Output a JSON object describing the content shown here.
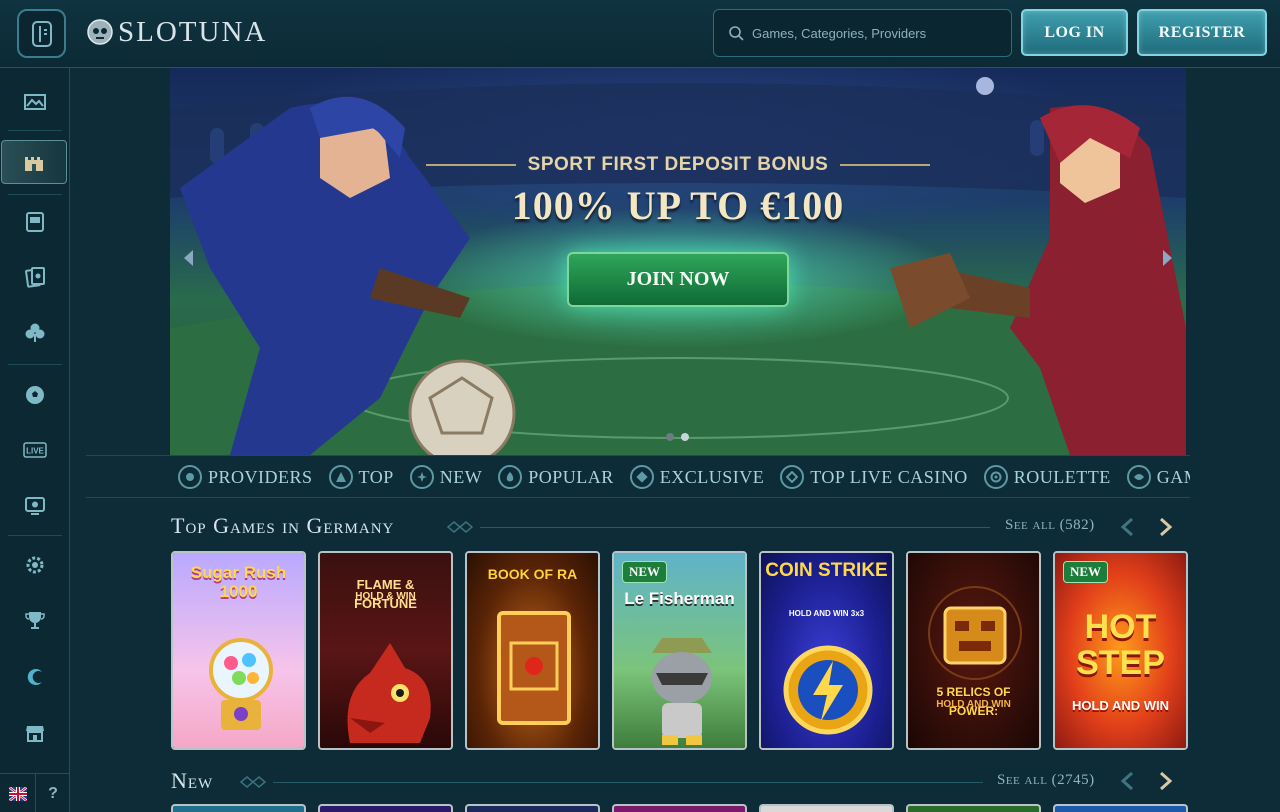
{
  "header": {
    "logo_text": "SLOTUNA",
    "search_placeholder": "Games, Categories, Providers",
    "login_label": "LOG IN",
    "register_label": "REGISTER"
  },
  "sidebar": {
    "items": [
      {
        "icon": "slots-icon",
        "active": false
      },
      {
        "icon": "castle-icon",
        "active": true
      },
      {
        "icon": "slot-machine-icon",
        "active": false
      },
      {
        "icon": "cards-icon",
        "active": false
      },
      {
        "icon": "club-icon",
        "active": false
      },
      {
        "icon": "soccer-ball-icon",
        "active": false
      },
      {
        "icon": "live-icon",
        "active": false,
        "label": "LIVE"
      },
      {
        "icon": "esports-icon",
        "active": false
      },
      {
        "icon": "gear-badge-icon",
        "active": false
      },
      {
        "icon": "trophy-icon",
        "active": false
      },
      {
        "icon": "crescent-icon",
        "active": false
      },
      {
        "icon": "shop-icon",
        "active": false
      }
    ],
    "language": "EN",
    "help_label": "?"
  },
  "banner": {
    "subtitle": "SPORT FIRST DEPOSIT BONUS",
    "title": "100% UP TO €100",
    "cta_label": "JOIN NOW",
    "slides": 2,
    "active_slide": 2
  },
  "categories": [
    "PROVIDERS",
    "TOP",
    "NEW",
    "POPULAR",
    "EXCLUSIVE",
    "TOP LIVE CASINO",
    "ROULETTE",
    "GAME SH"
  ],
  "sections": [
    {
      "title": "Top Games in Germany",
      "see_all": "See all (582)",
      "games": [
        {
          "name": "Sugar Rush 1000",
          "badge": "",
          "sub": ""
        },
        {
          "name": "FLAME & FORTUNE",
          "badge": "",
          "sub": "HOLD & WIN"
        },
        {
          "name": "BOOK OF RA",
          "badge": "",
          "sub": ""
        },
        {
          "name": "Le Fisherman",
          "badge": "NEW",
          "sub": ""
        },
        {
          "name": "COIN STRIKE",
          "badge": "",
          "sub": "HOLD AND WIN 3x3"
        },
        {
          "name": "5 RELICS OF POWER:",
          "badge": "",
          "sub": "HOLD AND WIN"
        },
        {
          "name": "HOT STEP",
          "badge": "NEW",
          "sub": "HOLD AND WIN"
        }
      ]
    },
    {
      "title": "New",
      "see_all": "See all (2745)"
    }
  ],
  "colors": {
    "background": "#0d2c37",
    "accent": "#3f9fae",
    "cta_green": "#1d8a45",
    "text_gold": "#f3e6c2"
  }
}
